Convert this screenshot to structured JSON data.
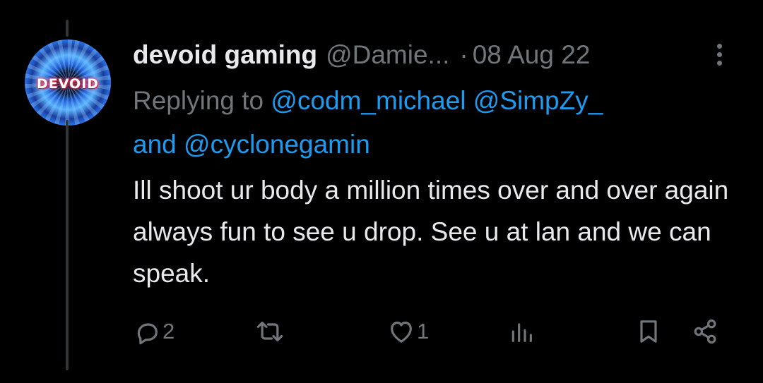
{
  "author": {
    "display_name": "devoid gaming",
    "handle": "@Damie...",
    "separator": "·",
    "date": "08 Aug 22",
    "avatar_text": "DEVOID"
  },
  "reply": {
    "prefix": "Replying to",
    "mention_1": "@codm_michael",
    "mention_2": "@SimpZy_",
    "and": "and",
    "mention_3": "@cyclonegamin"
  },
  "tweet_text": "Ill shoot ur body a million times over and over again always fun to see u drop. See u at lan and we can speak.",
  "actions": {
    "reply_count": "2",
    "like_count": "1"
  },
  "icons": [
    "more-icon",
    "reply-icon",
    "retweet-icon",
    "like-icon",
    "views-icon",
    "bookmark-icon",
    "share-icon"
  ],
  "colors": {
    "background": "#000000",
    "text": "#e7e9ea",
    "muted": "#71767b",
    "link": "#1d9bf0",
    "thread_line": "#333639"
  }
}
